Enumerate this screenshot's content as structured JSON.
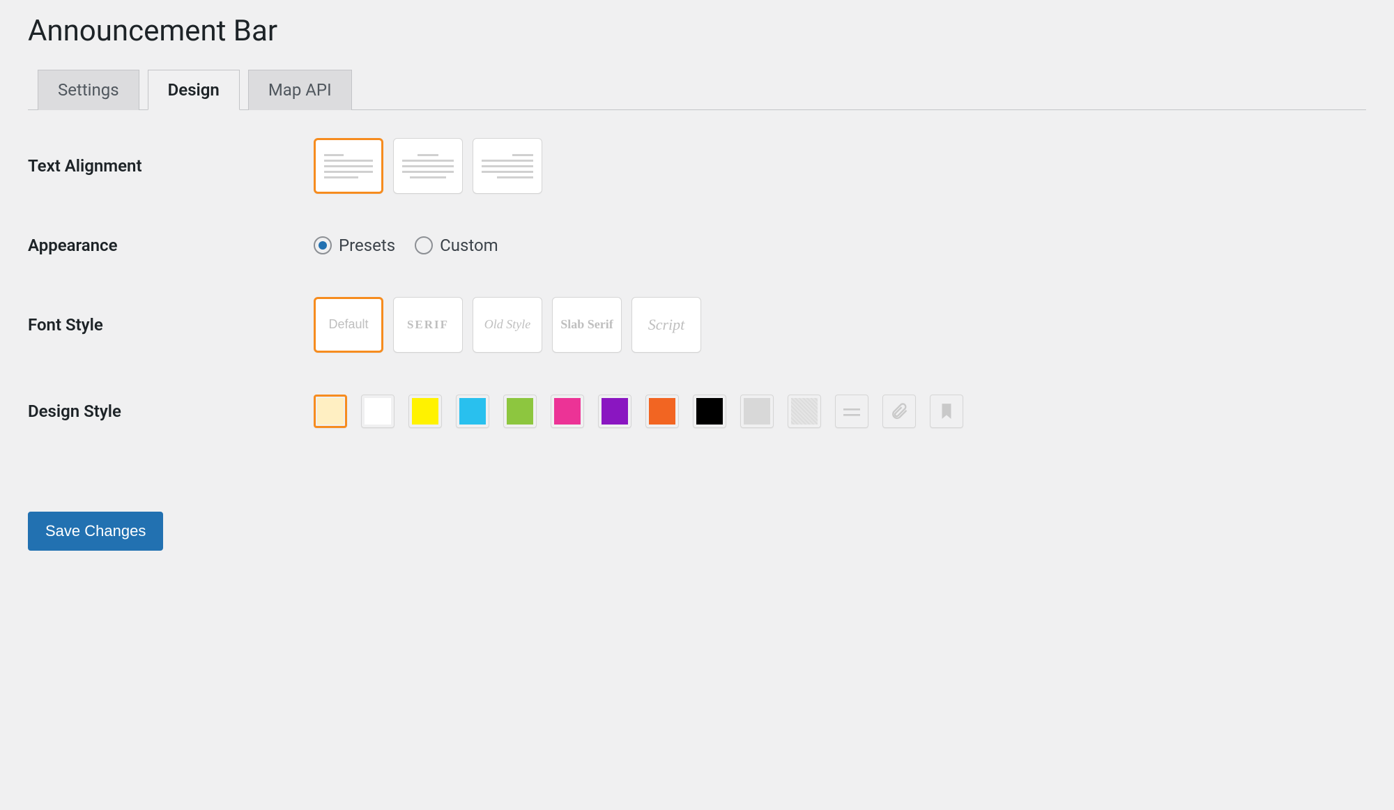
{
  "page_title": "Announcement Bar",
  "tabs": [
    {
      "label": "Settings",
      "active": false
    },
    {
      "label": "Design",
      "active": true
    },
    {
      "label": "Map API",
      "active": false
    }
  ],
  "fields": {
    "text_alignment": {
      "label": "Text Alignment",
      "options": [
        "left",
        "center",
        "right"
      ],
      "selected": "left"
    },
    "appearance": {
      "label": "Appearance",
      "options": [
        "Presets",
        "Custom"
      ],
      "selected": "Presets"
    },
    "font_style": {
      "label": "Font Style",
      "options": [
        {
          "id": "default",
          "label": "Default"
        },
        {
          "id": "serif",
          "label": "SERIF"
        },
        {
          "id": "old_style",
          "label": "Old Style"
        },
        {
          "id": "slab_serif",
          "label": "Slab Serif"
        },
        {
          "id": "script",
          "label": "Script"
        }
      ],
      "selected": "default"
    },
    "design_style": {
      "label": "Design Style",
      "options": [
        {
          "id": "cream",
          "type": "color",
          "value": "#ffefc2"
        },
        {
          "id": "white",
          "type": "color",
          "value": "#ffffff"
        },
        {
          "id": "yellow",
          "type": "color",
          "value": "#fff200"
        },
        {
          "id": "sky",
          "type": "color",
          "value": "#29c0ee"
        },
        {
          "id": "lime",
          "type": "color",
          "value": "#8dc63f"
        },
        {
          "id": "pink",
          "type": "color",
          "value": "#ec3396"
        },
        {
          "id": "purple",
          "type": "color",
          "value": "#8a16c1"
        },
        {
          "id": "orange",
          "type": "color",
          "value": "#f26522"
        },
        {
          "id": "black",
          "type": "color",
          "value": "#000000"
        },
        {
          "id": "gray",
          "type": "color",
          "value": "#d8d8d8"
        },
        {
          "id": "noise",
          "type": "texture",
          "value": "noise"
        },
        {
          "id": "stripe",
          "type": "icon",
          "value": "stripe"
        },
        {
          "id": "clip",
          "type": "icon",
          "value": "clip"
        },
        {
          "id": "bookmark",
          "type": "icon",
          "value": "bookmark"
        }
      ],
      "selected": "cream"
    }
  },
  "save_label": "Save Changes"
}
